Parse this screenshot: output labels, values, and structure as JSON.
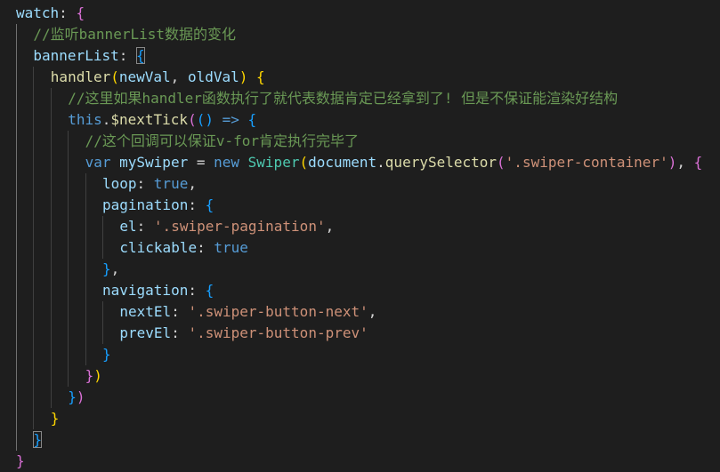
{
  "editor": {
    "language": "javascript",
    "theme": "dark",
    "colors": {
      "background": "#1e1e1e",
      "keyword": "#569cd6",
      "property": "#9cdcfe",
      "function": "#dcdcaa",
      "string": "#ce9178",
      "comment": "#6a9955",
      "type": "#4ec9b0",
      "bracket_level_1": "#ffd700",
      "bracket_level_2": "#da70d6",
      "bracket_level_3": "#179fff"
    },
    "lines": [
      {
        "indent": 0,
        "tokens": [
          [
            "p",
            "watch"
          ],
          [
            "d",
            ": "
          ],
          [
            "b2",
            "{"
          ]
        ]
      },
      {
        "indent": 1,
        "tokens": [
          [
            "c",
            "//监听bannerList数据的变化"
          ]
        ]
      },
      {
        "indent": 1,
        "tokens": [
          [
            "p",
            "bannerList"
          ],
          [
            "d",
            ": "
          ],
          [
            "b3",
            "{",
            "matched"
          ]
        ]
      },
      {
        "indent": 2,
        "tokens": [
          [
            "f",
            "handler"
          ],
          [
            "b1",
            "("
          ],
          [
            "p",
            "newVal"
          ],
          [
            "d",
            ", "
          ],
          [
            "p",
            "oldVal"
          ],
          [
            "b1",
            ")"
          ],
          [
            "d",
            " "
          ],
          [
            "b1",
            "{"
          ]
        ]
      },
      {
        "indent": 3,
        "tokens": [
          [
            "c",
            "//这里如果handler函数执行了就代表数据肯定已经拿到了! 但是不保证能渲染好结构"
          ]
        ]
      },
      {
        "indent": 3,
        "tokens": [
          [
            "k",
            "this"
          ],
          [
            "d",
            "."
          ],
          [
            "f",
            "$nextTick"
          ],
          [
            "b2",
            "("
          ],
          [
            "b3",
            "("
          ],
          [
            "b3",
            ")"
          ],
          [
            "d",
            " "
          ],
          [
            "k",
            "=>"
          ],
          [
            "d",
            " "
          ],
          [
            "b3",
            "{"
          ]
        ]
      },
      {
        "indent": 4,
        "tokens": [
          [
            "c",
            "//这个回调可以保证v-for肯定执行完毕了"
          ]
        ]
      },
      {
        "indent": 4,
        "tokens": [
          [
            "k",
            "var"
          ],
          [
            "d",
            " "
          ],
          [
            "p",
            "mySwiper"
          ],
          [
            "d",
            " = "
          ],
          [
            "k",
            "new"
          ],
          [
            "d",
            " "
          ],
          [
            "t",
            "Swiper"
          ],
          [
            "b1",
            "("
          ],
          [
            "p",
            "document"
          ],
          [
            "d",
            "."
          ],
          [
            "f",
            "querySelector"
          ],
          [
            "b2",
            "("
          ],
          [
            "s",
            "'.swiper-container'"
          ],
          [
            "b2",
            ")"
          ],
          [
            "d",
            ", "
          ],
          [
            "b2",
            "{"
          ]
        ]
      },
      {
        "indent": 5,
        "tokens": [
          [
            "p",
            "loop"
          ],
          [
            "d",
            ": "
          ],
          [
            "k",
            "true"
          ],
          [
            "d",
            ","
          ]
        ]
      },
      {
        "indent": 5,
        "tokens": [
          [
            "p",
            "pagination"
          ],
          [
            "d",
            ": "
          ],
          [
            "b3",
            "{"
          ]
        ]
      },
      {
        "indent": 6,
        "tokens": [
          [
            "p",
            "el"
          ],
          [
            "d",
            ": "
          ],
          [
            "s",
            "'.swiper-pagination'"
          ],
          [
            "d",
            ","
          ]
        ]
      },
      {
        "indent": 6,
        "tokens": [
          [
            "p",
            "clickable"
          ],
          [
            "d",
            ": "
          ],
          [
            "k",
            "true"
          ]
        ]
      },
      {
        "indent": 5,
        "tokens": [
          [
            "b3",
            "}"
          ],
          [
            "d",
            ","
          ]
        ]
      },
      {
        "indent": 5,
        "tokens": [
          [
            "p",
            "navigation"
          ],
          [
            "d",
            ": "
          ],
          [
            "b3",
            "{"
          ]
        ]
      },
      {
        "indent": 6,
        "tokens": [
          [
            "p",
            "nextEl"
          ],
          [
            "d",
            ": "
          ],
          [
            "s",
            "'.swiper-button-next'"
          ],
          [
            "d",
            ","
          ]
        ]
      },
      {
        "indent": 6,
        "tokens": [
          [
            "p",
            "prevEl"
          ],
          [
            "d",
            ": "
          ],
          [
            "s",
            "'.swiper-button-prev'"
          ]
        ]
      },
      {
        "indent": 5,
        "tokens": [
          [
            "b3",
            "}"
          ]
        ]
      },
      {
        "indent": 4,
        "tokens": [
          [
            "b2",
            "}"
          ],
          [
            "b1",
            ")"
          ]
        ]
      },
      {
        "indent": 3,
        "tokens": [
          [
            "b3",
            "}"
          ],
          [
            "b2",
            ")"
          ]
        ]
      },
      {
        "indent": 2,
        "tokens": [
          [
            "b1",
            "}"
          ]
        ]
      },
      {
        "indent": 1,
        "tokens": [
          [
            "b3",
            "}",
            "matched"
          ]
        ]
      },
      {
        "indent": 0,
        "tokens": [
          [
            "b2",
            "}"
          ]
        ]
      }
    ]
  }
}
